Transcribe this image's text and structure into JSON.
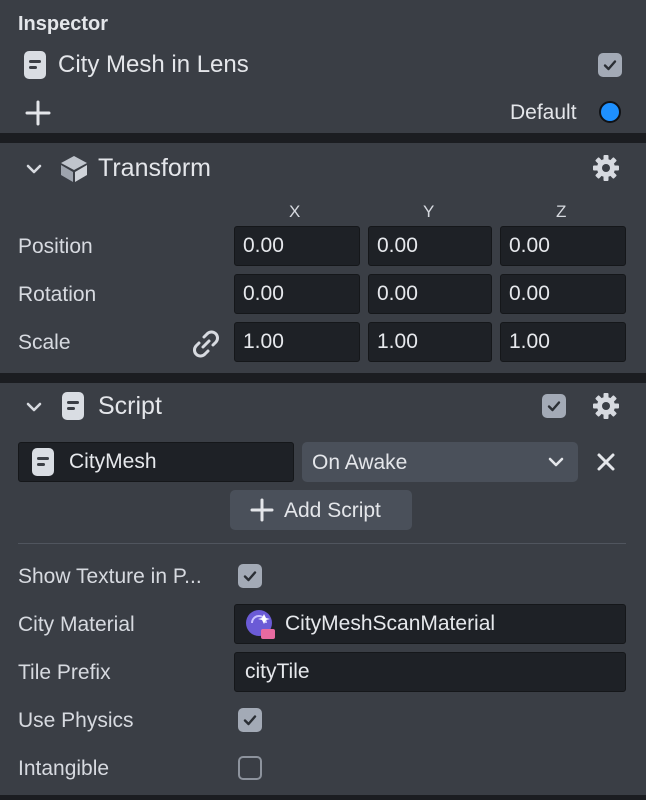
{
  "inspector": {
    "header": "Inspector",
    "object_name": "City Mesh in Lens",
    "object_enabled": true,
    "layer_label": "Default",
    "layer_color": "#1e90ff"
  },
  "transform": {
    "title": "Transform",
    "axes": [
      "X",
      "Y",
      "Z"
    ],
    "rows": [
      {
        "label": "Position",
        "x": "0.00",
        "y": "0.00",
        "z": "0.00"
      },
      {
        "label": "Rotation",
        "x": "0.00",
        "y": "0.00",
        "z": "0.00"
      },
      {
        "label": "Scale",
        "x": "1.00",
        "y": "1.00",
        "z": "1.00"
      }
    ]
  },
  "script": {
    "title": "Script",
    "enabled": true,
    "script_name": "CityMesh",
    "event": "On Awake",
    "add_button": "Add Script",
    "properties": {
      "show_texture_label": "Show Texture in P...",
      "show_texture_checked": true,
      "city_material_label": "City Material",
      "city_material_value": "CityMeshScanMaterial",
      "tile_prefix_label": "Tile Prefix",
      "tile_prefix_value": "cityTile",
      "use_physics_label": "Use Physics",
      "use_physics_checked": true,
      "intangible_label": "Intangible",
      "intangible_checked": false
    }
  },
  "colors": {
    "panel_bg": "#3a3e45",
    "field_bg": "#1e2126",
    "accent_blue": "#1e90ff"
  }
}
